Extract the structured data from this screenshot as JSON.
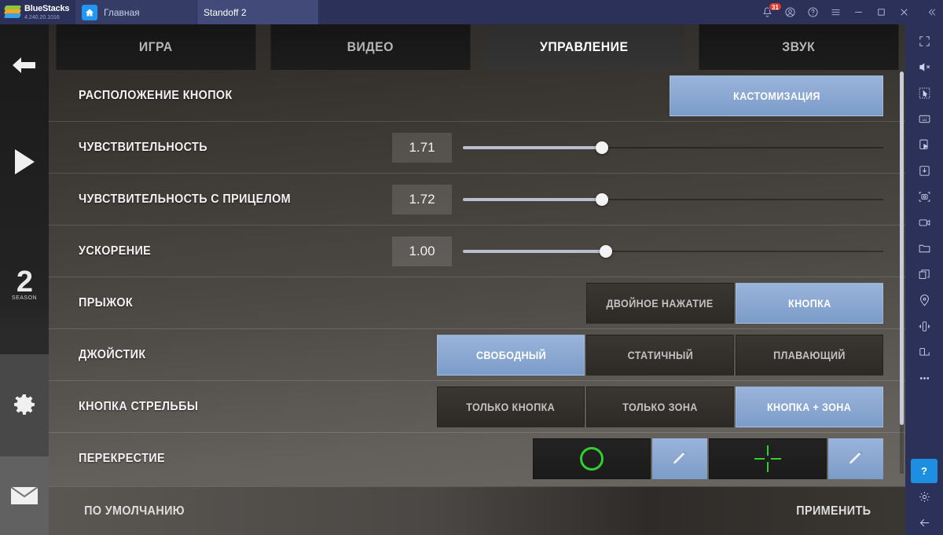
{
  "window": {
    "brand": "BlueStacks",
    "version": "4.240.20.1016",
    "tabs": [
      {
        "label": "Главная",
        "icon": "home-icon",
        "active": false
      },
      {
        "label": "Standoff 2",
        "icon": "game-thumbnail",
        "active": true
      }
    ],
    "controls": {
      "notifications_badge": "31",
      "notifications_icon": "bell-icon",
      "account_icon": "account-icon",
      "help_icon": "help-circle-icon",
      "menu_icon": "hamburger-menu-icon",
      "minimize_icon": "minimize-icon",
      "maximize_icon": "maximize-icon",
      "close_icon": "close-icon",
      "collapse_icon": "chevron-double-left-icon"
    }
  },
  "left_rail": {
    "items": [
      {
        "icon": "back-arrow-icon",
        "name": "back"
      },
      {
        "icon": "play-icon",
        "name": "play"
      },
      {
        "icon": "season-badge",
        "number": "2",
        "label": "SEASON"
      },
      {
        "icon": "gear-icon",
        "name": "settings"
      },
      {
        "icon": "envelope-icon",
        "name": "mail"
      }
    ]
  },
  "right_toolbar": {
    "items": [
      "fullscreen-icon",
      "mute-icon",
      "select-region-icon",
      "keyboard-icon",
      "macro-script-icon",
      "install-apk-icon",
      "screenshot-icon",
      "record-video-icon",
      "folder-icon",
      "multi-instance-icon",
      "location-pin-icon",
      "shake-icon",
      "rotate-screen-icon",
      "more-options-icon"
    ],
    "help_label": "?",
    "settings_icon": "gear-icon",
    "back_icon": "back-arrow-icon"
  },
  "game": {
    "tabs": [
      {
        "label": "ИГРА",
        "active": false
      },
      {
        "label": "ВИДЕО",
        "active": false
      },
      {
        "label": "УПРАВЛЕНИЕ",
        "active": true
      },
      {
        "label": "ЗВУК",
        "active": false
      }
    ],
    "rows": {
      "button_layout": {
        "label": "РАСПОЛОЖЕНИЕ КНОПОК",
        "button": "КАСТОМИЗАЦИЯ"
      },
      "sensitivity": {
        "label": "ЧУВСТВИТЕЛЬНОСТЬ",
        "value": "1.71",
        "percent": 33
      },
      "aim_sensitivity": {
        "label": "ЧУВСТВИТЕЛЬНОСТЬ С ПРИЦЕЛОМ",
        "value": "1.72",
        "percent": 33
      },
      "acceleration": {
        "label": "УСКОРЕНИЕ",
        "value": "1.00",
        "percent": 34
      },
      "jump": {
        "label": "ПРЫЖОК",
        "options": [
          {
            "label": "ДВОЙНОЕ НАЖАТИЕ",
            "active": false
          },
          {
            "label": "КНОПКА",
            "active": true
          }
        ]
      },
      "joystick": {
        "label": "ДЖОЙСТИК",
        "options": [
          {
            "label": "СВОБОДНЫЙ",
            "active": true
          },
          {
            "label": "СТАТИЧНЫЙ",
            "active": false
          },
          {
            "label": "ПЛАВАЮЩИЙ",
            "active": false
          }
        ]
      },
      "fire_button": {
        "label": "КНОПКА СТРЕЛЬБЫ",
        "options": [
          {
            "label": "ТОЛЬКО КНОПКА",
            "active": false
          },
          {
            "label": "ТОЛЬКО ЗОНА",
            "active": false
          },
          {
            "label": "КНОПКА + ЗОНА",
            "active": true
          }
        ]
      },
      "crosshair": {
        "label": "ПЕРЕКРЕСТИЕ",
        "preview_ring": "green-ring-crosshair",
        "edit_ring": "pencil-edit-icon",
        "preview_cross": "green-cross-crosshair",
        "edit_cross": "pencil-edit-icon"
      }
    },
    "footer": {
      "defaults": "ПО УМОЛЧАНИЮ",
      "apply": "ПРИМЕНИТЬ"
    }
  },
  "colors": {
    "accent_blue": "#7b9cc9",
    "crosshair_green": "#2fd02f",
    "badge_red": "#e0392b",
    "chrome_navy": "#2b3158"
  }
}
